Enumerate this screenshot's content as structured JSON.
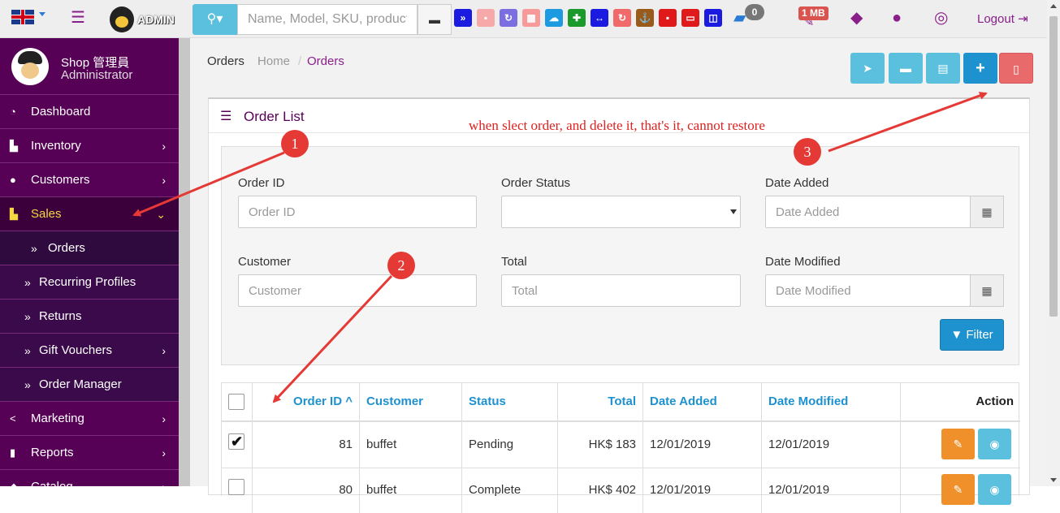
{
  "topbar": {
    "logo_text": "ADMIN",
    "search_placeholder": "Name, Model, SKU, product_",
    "notif_count": "0",
    "storage_badge": "1 MB",
    "logout_label": "Logout"
  },
  "sidebar": {
    "user_name": "Shop 管理員",
    "user_role": "Administrator",
    "items": [
      {
        "label": "Dashboard",
        "icon": "dashboard-icon",
        "chevron": ""
      },
      {
        "label": "Inventory",
        "icon": "cart-icon",
        "chevron": "›"
      },
      {
        "label": "Customers",
        "icon": "user-icon",
        "chevron": "›"
      },
      {
        "label": "Sales",
        "icon": "cart-icon",
        "chevron": "⌄"
      },
      {
        "label": "Orders",
        "icon": "double-chevron-icon",
        "chevron": ""
      },
      {
        "label": "Recurring Profiles",
        "icon": "double-chevron-icon",
        "chevron": ""
      },
      {
        "label": "Returns",
        "icon": "double-chevron-icon",
        "chevron": ""
      },
      {
        "label": "Gift Vouchers",
        "icon": "double-chevron-icon",
        "chevron": "›"
      },
      {
        "label": "Order Manager",
        "icon": "double-chevron-icon",
        "chevron": ""
      },
      {
        "label": "Marketing",
        "icon": "share-icon",
        "chevron": "›"
      },
      {
        "label": "Reports",
        "icon": "bar-chart-icon",
        "chevron": "›"
      },
      {
        "label": "Catalog",
        "icon": "tag-icon",
        "chevron": "›"
      }
    ]
  },
  "breadcrumb": {
    "title": "Orders",
    "home": "Home",
    "sep": "/",
    "current": "Orders"
  },
  "panel": {
    "title": "Order List"
  },
  "annotation": {
    "note": "when slect order, and delete it, that's it, cannot restore",
    "callouts": [
      "1",
      "2",
      "3"
    ]
  },
  "filters": {
    "order_id_label": "Order ID",
    "order_id_placeholder": "Order ID",
    "status_label": "Order Status",
    "date_added_label": "Date Added",
    "date_added_placeholder": "Date Added",
    "customer_label": "Customer",
    "customer_placeholder": "Customer",
    "total_label": "Total",
    "total_placeholder": "Total",
    "date_modified_label": "Date Modified",
    "date_modified_placeholder": "Date Modified",
    "filter_button": "Filter"
  },
  "table": {
    "headers": [
      "Order ID",
      "Customer",
      "Status",
      "Total",
      "Date Added",
      "Date Modified",
      "Action"
    ],
    "sort_indicator": "^",
    "rows": [
      {
        "checked": true,
        "order_id": "81",
        "customer": "buffet",
        "status": "Pending",
        "total": "HK$ 183",
        "date_added": "12/01/2019",
        "date_modified": "12/01/2019"
      },
      {
        "checked": false,
        "order_id": "80",
        "customer": "buffet",
        "status": "Complete",
        "total": "HK$ 402",
        "date_added": "12/01/2019",
        "date_modified": "12/01/2019"
      }
    ]
  },
  "colors": {
    "sidebar": "#560056",
    "accent": "#1e91cf",
    "danger": "#e86a6a",
    "warning": "#f0902a",
    "info": "#5bc0de"
  }
}
